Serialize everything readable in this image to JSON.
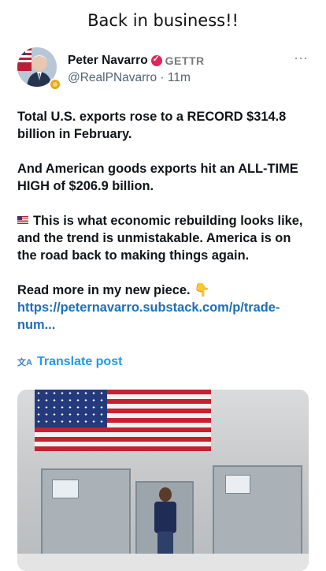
{
  "caption": "Back in business!!",
  "post": {
    "author": {
      "name": "Peter Navarro",
      "platform": "GETTR",
      "handle": "@RealPNavarro",
      "separator": "·",
      "time": "11m"
    },
    "paragraphs": [
      "Total U.S. exports rose to a RECORD $314.8 billion in February.",
      "And American goods exports hit an ALL-TIME HIGH of $206.9 billion.",
      "This is what economic rebuilding looks like, and the trend is unmistakable. America is on the road back to making things again."
    ],
    "read_more": "Read more in my new piece.",
    "read_more_emoji": "👇",
    "link_text": "https://peternavarro.substack.com/p/trade-num...",
    "translate_label": "Translate post",
    "more_icon": "⋯"
  },
  "colors": {
    "link": "#1d6fb8",
    "translate": "#1d9bf0",
    "verify_badge": "#e0245e"
  },
  "icons": [
    "more-icon",
    "verified-icon",
    "flag-emoji-icon",
    "translate-icon"
  ]
}
